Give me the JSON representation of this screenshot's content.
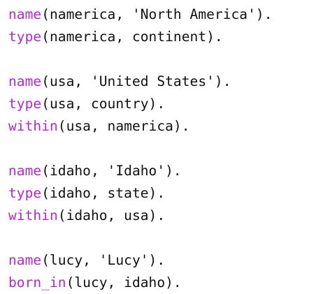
{
  "colors": {
    "background": "#ffffff",
    "predicate": "#b02ad0",
    "text": "#111111"
  },
  "code": {
    "blocks": [
      {
        "lines": [
          {
            "pred": "name",
            "args": "(namerica, 'North America')."
          },
          {
            "pred": "type",
            "args": "(namerica, continent)."
          }
        ]
      },
      {
        "lines": [
          {
            "pred": "name",
            "args": "(usa, 'United States')."
          },
          {
            "pred": "type",
            "args": "(usa, country)."
          },
          {
            "pred": "within",
            "args": "(usa, namerica)."
          }
        ]
      },
      {
        "lines": [
          {
            "pred": "name",
            "args": "(idaho, 'Idaho')."
          },
          {
            "pred": "type",
            "args": "(idaho, state)."
          },
          {
            "pred": "within",
            "args": "(idaho, usa)."
          }
        ]
      },
      {
        "lines": [
          {
            "pred": "name",
            "args": "(lucy, 'Lucy')."
          },
          {
            "pred": "born_in",
            "args": "(lucy, idaho)."
          }
        ]
      }
    ]
  }
}
